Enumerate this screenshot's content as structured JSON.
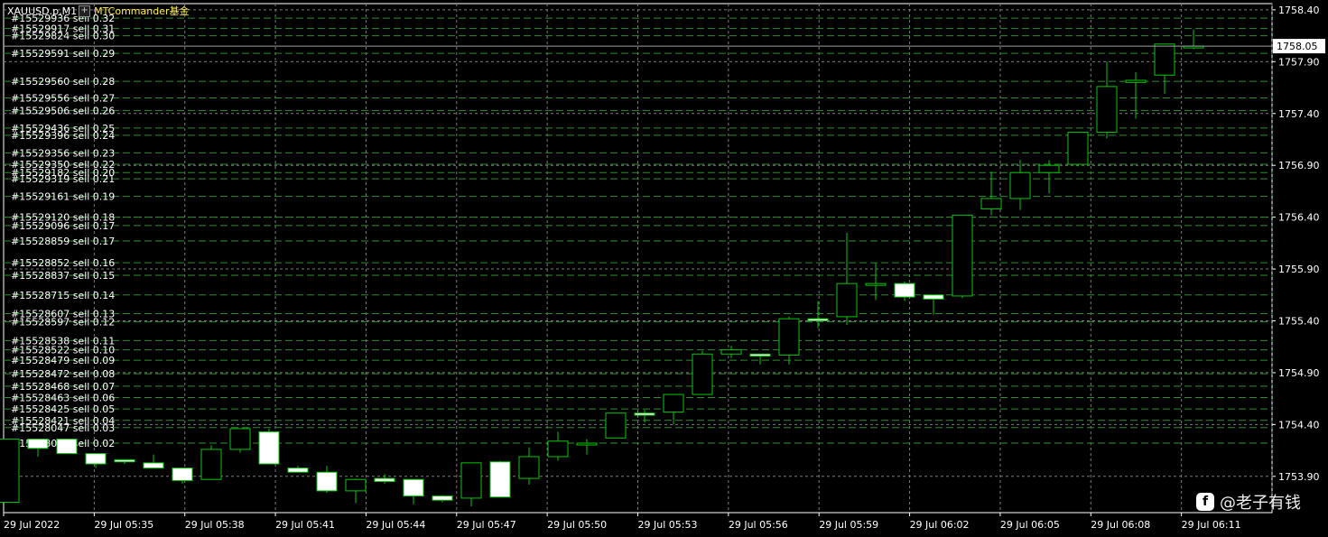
{
  "header": {
    "symbol": "XAUUSD.p,M1",
    "toggle_label": "+",
    "ea_name": "MTCommander基金"
  },
  "watermark": {
    "logo_icon": "social-logo-icon",
    "text": "@老子有钱"
  },
  "colors": {
    "background": "#000000",
    "grid": "#7a7a7a",
    "axis": "#ffffff",
    "bull_body": "#000000",
    "bear_body": "#ffffff",
    "candle_outline": "#00c800",
    "order_line": "#2e8b2e",
    "label_text": "#ffffff",
    "current_price_bg": "#ffffff"
  },
  "chart_data": {
    "type": "candlestick",
    "symbol": "XAUUSD.p",
    "timeframe": "M1",
    "ylim": [
      1753.55,
      1758.46
    ],
    "y_ticks": [
      "1758.40",
      "1757.90",
      "1757.40",
      "1756.90",
      "1756.40",
      "1755.90",
      "1755.40",
      "1754.90",
      "1754.40",
      "1753.90"
    ],
    "current_price": "1758.05",
    "x_ticks": [
      "29 Jul 2022",
      "29 Jul 05:35",
      "29 Jul 05:38",
      "29 Jul 05:41",
      "29 Jul 05:44",
      "29 Jul 05:47",
      "29 Jul 05:50",
      "29 Jul 05:53",
      "29 Jul 05:56",
      "29 Jul 05:59",
      "29 Jul 06:02",
      "29 Jul 06:05",
      "29 Jul 06:08",
      "29 Jul 06:11"
    ],
    "candles": [
      {
        "o": 1753.65,
        "h": 1754.26,
        "l": 1753.65,
        "c": 1754.26
      },
      {
        "o": 1754.26,
        "h": 1754.26,
        "l": 1754.09,
        "c": 1754.17
      },
      {
        "o": 1754.26,
        "h": 1754.26,
        "l": 1754.12,
        "c": 1754.12
      },
      {
        "o": 1754.12,
        "h": 1754.12,
        "l": 1753.98,
        "c": 1754.02
      },
      {
        "o": 1754.06,
        "h": 1754.06,
        "l": 1754.02,
        "c": 1754.04
      },
      {
        "o": 1754.03,
        "h": 1754.11,
        "l": 1753.98,
        "c": 1753.98
      },
      {
        "o": 1753.98,
        "h": 1753.98,
        "l": 1753.83,
        "c": 1753.86
      },
      {
        "o": 1753.87,
        "h": 1754.2,
        "l": 1753.87,
        "c": 1754.16
      },
      {
        "o": 1754.16,
        "h": 1754.36,
        "l": 1754.13,
        "c": 1754.36
      },
      {
        "o": 1754.33,
        "h": 1754.36,
        "l": 1754.02,
        "c": 1754.02
      },
      {
        "o": 1753.98,
        "h": 1754.0,
        "l": 1753.95,
        "c": 1753.94
      },
      {
        "o": 1753.94,
        "h": 1754.0,
        "l": 1753.74,
        "c": 1753.76
      },
      {
        "o": 1753.76,
        "h": 1753.88,
        "l": 1753.64,
        "c": 1753.87
      },
      {
        "o": 1753.88,
        "h": 1753.92,
        "l": 1753.83,
        "c": 1753.85
      },
      {
        "o": 1753.87,
        "h": 1753.87,
        "l": 1753.63,
        "c": 1753.71
      },
      {
        "o": 1753.71,
        "h": 1753.72,
        "l": 1753.65,
        "c": 1753.67
      },
      {
        "o": 1753.69,
        "h": 1754.03,
        "l": 1753.61,
        "c": 1754.03
      },
      {
        "o": 1754.04,
        "h": 1754.05,
        "l": 1753.7,
        "c": 1753.7
      },
      {
        "o": 1753.88,
        "h": 1754.18,
        "l": 1753.82,
        "c": 1754.09
      },
      {
        "o": 1754.09,
        "h": 1754.33,
        "l": 1754.05,
        "c": 1754.24
      },
      {
        "o": 1754.22,
        "h": 1754.26,
        "l": 1754.11,
        "c": 1754.22
      },
      {
        "o": 1754.27,
        "h": 1754.32,
        "l": 1754.27,
        "c": 1754.51
      },
      {
        "o": 1754.51,
        "h": 1754.54,
        "l": 1754.42,
        "c": 1754.49
      },
      {
        "o": 1754.52,
        "h": 1754.58,
        "l": 1754.4,
        "c": 1754.69
      },
      {
        "o": 1754.69,
        "h": 1755.11,
        "l": 1754.7,
        "c": 1755.08
      },
      {
        "o": 1755.08,
        "h": 1755.16,
        "l": 1755.04,
        "c": 1755.12
      },
      {
        "o": 1755.08,
        "h": 1755.08,
        "l": 1754.98,
        "c": 1755.06
      },
      {
        "o": 1755.07,
        "h": 1755.44,
        "l": 1754.98,
        "c": 1755.42
      },
      {
        "o": 1755.42,
        "h": 1755.59,
        "l": 1755.33,
        "c": 1755.4
      },
      {
        "o": 1755.44,
        "h": 1756.25,
        "l": 1755.36,
        "c": 1755.76
      },
      {
        "o": 1755.75,
        "h": 1755.96,
        "l": 1755.6,
        "c": 1755.76
      },
      {
        "o": 1755.76,
        "h": 1755.78,
        "l": 1755.59,
        "c": 1755.63
      },
      {
        "o": 1755.65,
        "h": 1755.65,
        "l": 1755.46,
        "c": 1755.61
      },
      {
        "o": 1755.64,
        "h": 1756.42,
        "l": 1755.62,
        "c": 1756.42
      },
      {
        "o": 1756.48,
        "h": 1756.84,
        "l": 1756.42,
        "c": 1756.58
      },
      {
        "o": 1756.58,
        "h": 1756.95,
        "l": 1756.47,
        "c": 1756.83
      },
      {
        "o": 1756.83,
        "h": 1756.95,
        "l": 1756.63,
        "c": 1756.9
      },
      {
        "o": 1756.91,
        "h": 1757.21,
        "l": 1756.89,
        "c": 1757.22
      },
      {
        "o": 1757.22,
        "h": 1757.9,
        "l": 1757.16,
        "c": 1757.66
      },
      {
        "o": 1757.7,
        "h": 1757.8,
        "l": 1757.35,
        "c": 1757.72
      },
      {
        "o": 1757.77,
        "h": 1758.07,
        "l": 1757.59,
        "c": 1758.07
      },
      {
        "o": 1758.05,
        "h": 1758.21,
        "l": 1758.02,
        "c": 1758.05
      }
    ],
    "orders": [
      {
        "label": "#15529936 sell 0.32",
        "price": 1758.32
      },
      {
        "label": "#15529917 sell 0.31",
        "price": 1758.22
      },
      {
        "label": "#15529824 sell 0.30",
        "price": 1758.15
      },
      {
        "label": "#15529591 sell 0.29",
        "price": 1757.98
      },
      {
        "label": "#15529560 sell 0.28",
        "price": 1757.71
      },
      {
        "label": "#15529556 sell 0.27",
        "price": 1757.55
      },
      {
        "label": "#15529506 sell 0.26",
        "price": 1757.43
      },
      {
        "label": "#15529436 sell 0.25",
        "price": 1757.26
      },
      {
        "label": "#15529396 sell 0.24",
        "price": 1757.19
      },
      {
        "label": "#15529356 sell 0.23",
        "price": 1757.02
      },
      {
        "label": "#15529350 sell 0.22",
        "price": 1756.91
      },
      {
        "label": "#15529182 sell 0.20",
        "price": 1756.83
      },
      {
        "label": "#15529319 sell 0.21",
        "price": 1756.77
      },
      {
        "label": "#15529161 sell 0.19",
        "price": 1756.6
      },
      {
        "label": "#15529120 sell 0.18",
        "price": 1756.4
      },
      {
        "label": "#15529096 sell 0.17",
        "price": 1756.32
      },
      {
        "label": "#15528859 sell 0.17",
        "price": 1756.17
      },
      {
        "label": "#15528852 sell 0.16",
        "price": 1755.96
      },
      {
        "label": "#15528837 sell 0.15",
        "price": 1755.84
      },
      {
        "label": "#15528715 sell 0.14",
        "price": 1755.65
      },
      {
        "label": "#15528607 sell 0.13",
        "price": 1755.47
      },
      {
        "label": "#15528597 sell 0.12",
        "price": 1755.39
      },
      {
        "label": "#15528538 sell 0.11",
        "price": 1755.21
      },
      {
        "label": "#15528522 sell 0.10",
        "price": 1755.12
      },
      {
        "label": "#15528479 sell 0.09",
        "price": 1755.02
      },
      {
        "label": "#15528472 sell 0.08",
        "price": 1754.89
      },
      {
        "label": "#15528468 sell 0.07",
        "price": 1754.77
      },
      {
        "label": "#15528463 sell 0.06",
        "price": 1754.66
      },
      {
        "label": "#15528425 sell 0.05",
        "price": 1754.55
      },
      {
        "label": "#15528421 sell 0.04",
        "price": 1754.44
      },
      {
        "label": "#15528047 sell 0.03",
        "price": 1754.37
      },
      {
        "label": "#15528000 sell 0.02",
        "price": 1754.22
      }
    ]
  }
}
